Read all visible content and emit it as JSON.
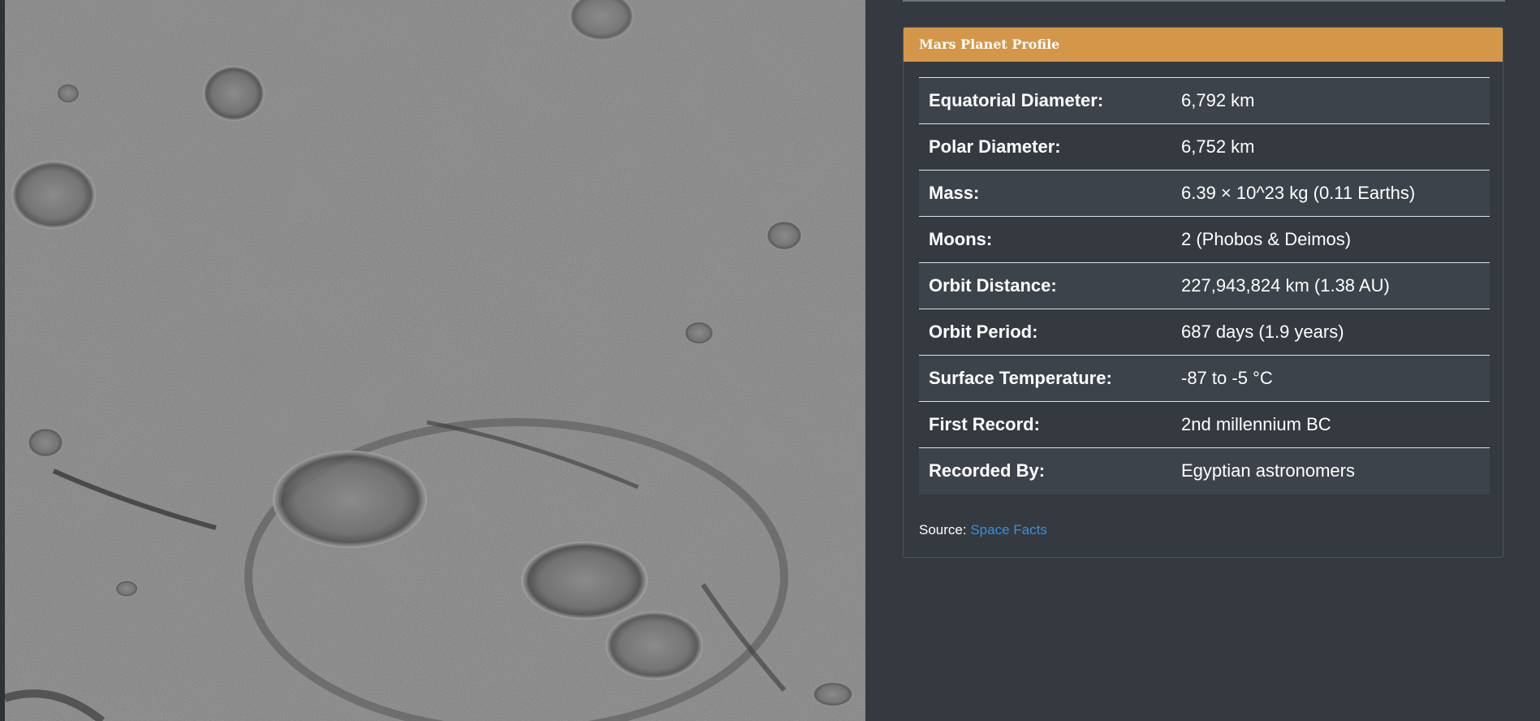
{
  "photo": {
    "alt": "Cratered planetary surface"
  },
  "profile": {
    "title": "Mars Planet Profile",
    "rows": [
      {
        "label": "Equatorial Diameter:",
        "value": "6,792 km"
      },
      {
        "label": "Polar Diameter:",
        "value": "6,752 km"
      },
      {
        "label": "Mass:",
        "value": "6.39 × 10^23 kg (0.11 Earths)"
      },
      {
        "label": "Moons:",
        "value": "2 (Phobos & Deimos)"
      },
      {
        "label": "Orbit Distance:",
        "value": "227,943,824 km (1.38 AU)"
      },
      {
        "label": "Orbit Period:",
        "value": "687 days (1.9 years)"
      },
      {
        "label": "Surface Temperature:",
        "value": "-87 to -5 °C"
      },
      {
        "label": "First Record:",
        "value": "2nd millennium BC"
      },
      {
        "label": "Recorded By:",
        "value": "Egyptian astronomers"
      }
    ],
    "source_prefix": "Source:",
    "source_link": "Space Facts"
  },
  "colors": {
    "page_bg": "#343a40",
    "header_bg": "#d4974a",
    "link": "#3a8fd9"
  }
}
